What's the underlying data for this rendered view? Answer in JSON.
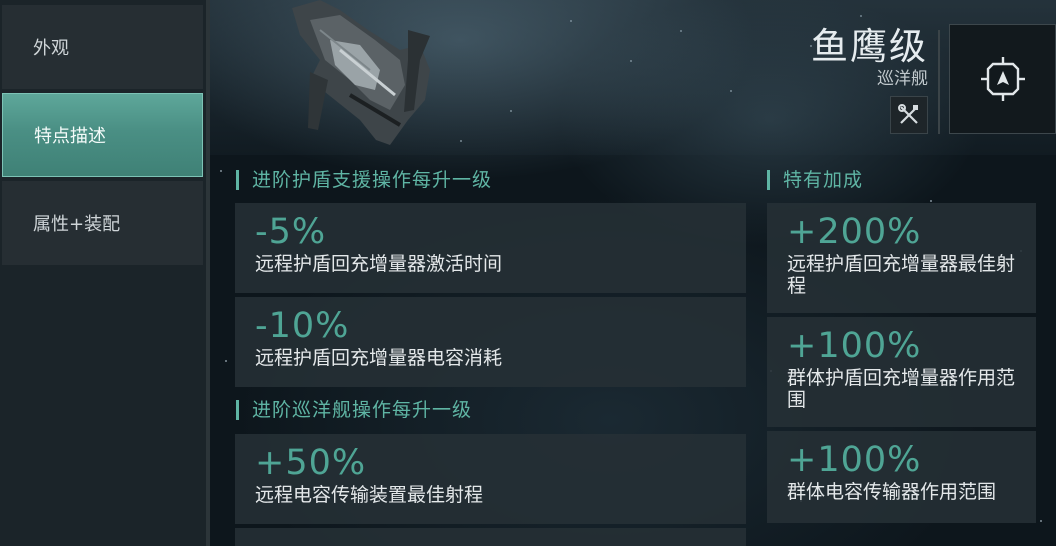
{
  "sidebar": {
    "items": [
      {
        "label": "外观",
        "active": false
      },
      {
        "label": "特点描述",
        "active": true
      },
      {
        "label": "属性+装配",
        "active": false
      }
    ]
  },
  "header": {
    "ship_name": "鱼鹰级",
    "ship_class": "巡洋舰",
    "fit_icon": "wrench-screwdriver-icon",
    "target_icon": "target-ship-icon"
  },
  "sections": {
    "shield_support": {
      "title": "进阶护盾支援操作每升一级",
      "bonuses": [
        {
          "value": "-5%",
          "desc": "远程护盾回充增量器激活时间"
        },
        {
          "value": "-10%",
          "desc": "远程护盾回充增量器电容消耗"
        }
      ]
    },
    "cruiser": {
      "title": "进阶巡洋舰操作每升一级",
      "bonuses": [
        {
          "value": "+50%",
          "desc": "远程电容传输装置最佳射程"
        }
      ]
    },
    "role": {
      "title": "特有加成",
      "bonuses": [
        {
          "value": "+200%",
          "desc": "远程护盾回充增量器最佳射程"
        },
        {
          "value": "+100%",
          "desc": "群体护盾回充增量器作用范围"
        },
        {
          "value": "+100%",
          "desc": "群体电容传输器作用范围"
        }
      ]
    }
  },
  "colors": {
    "accent": "#5fb5a4",
    "value_green": "#4fa595",
    "active_tab": "#4a8f84"
  }
}
